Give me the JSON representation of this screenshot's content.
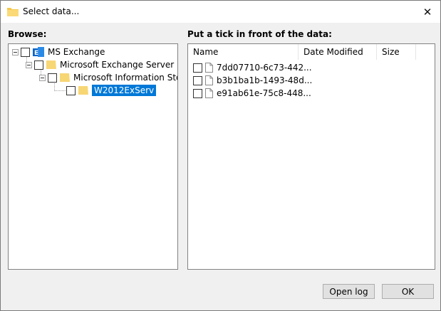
{
  "window": {
    "title": "Select data..."
  },
  "browse": {
    "label": "Browse:",
    "tree": [
      {
        "label": "MS Exchange",
        "level": 0
      },
      {
        "label": "Microsoft Exchange Server",
        "level": 1
      },
      {
        "label": "Microsoft Information Store",
        "level": 2
      },
      {
        "label": "W2012ExServ",
        "level": 3,
        "selected": true
      }
    ]
  },
  "data": {
    "label": "Put a tick in front of the data:",
    "columns": [
      "Name",
      "Date Modified",
      "Size"
    ],
    "files": [
      {
        "name": "7dd07710-6c73-442..."
      },
      {
        "name": "b3b1ba1b-1493-48d..."
      },
      {
        "name": "e91ab61e-75c8-448..."
      }
    ]
  },
  "buttons": {
    "open_log": "Open log",
    "ok": "OK"
  },
  "colors": {
    "selection": "#0078d7",
    "folder": "#f7d674",
    "exchange": "#0a64c8"
  },
  "icons": {
    "title": "folder-icon",
    "close": "close-icon",
    "root": "exchange-icon",
    "file": "document-icon"
  }
}
